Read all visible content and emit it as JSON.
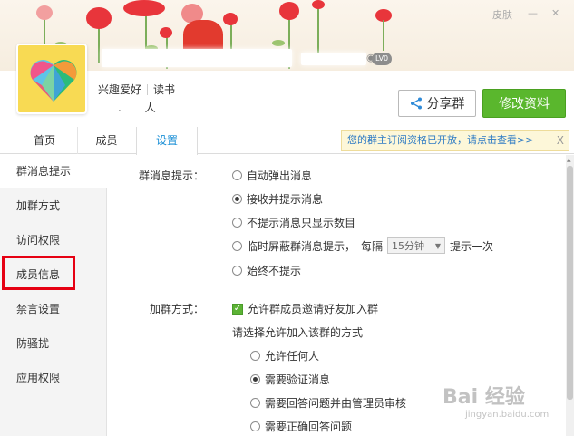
{
  "window": {
    "skin_label": "皮肤",
    "minimize": "—",
    "close": "✕"
  },
  "group": {
    "level_badge": "LV0",
    "tags": [
      "兴趣爱好",
      "读书"
    ],
    "member_dot": ".",
    "member_unit": "人"
  },
  "header": {
    "share_label": "分享群",
    "edit_label": "修改资料"
  },
  "tabs": [
    {
      "label": "首页"
    },
    {
      "label": "成员"
    },
    {
      "label": "设置"
    }
  ],
  "notice": {
    "text": "您的群主订阅资格已开放，请点击查看>>",
    "close": "X"
  },
  "sidebar": {
    "items": [
      {
        "label": "群消息提示"
      },
      {
        "label": "加群方式"
      },
      {
        "label": "访问权限"
      },
      {
        "label": "成员信息"
      },
      {
        "label": "禁言设置"
      },
      {
        "label": "防骚扰"
      },
      {
        "label": "应用权限"
      }
    ]
  },
  "settings": {
    "msg_label": "群消息提示：",
    "msg_options": [
      {
        "label": "自动弹出消息",
        "selected": false
      },
      {
        "label": "接收并提示消息",
        "selected": true
      },
      {
        "label": "不提示消息只显示数目",
        "selected": false
      },
      {
        "label": "临时屏蔽群消息提示，",
        "selected": false
      },
      {
        "label": "始终不提示",
        "selected": false
      }
    ],
    "every_label": "每隔",
    "interval_value": "15分钟",
    "interval_suffix": "提示一次",
    "join_label": "加群方式：",
    "allow_invite": "允许群成员邀请好友加入群",
    "choose_label": "请选择允许加入该群的方式",
    "join_options": [
      {
        "label": "允许任何人",
        "selected": false
      },
      {
        "label": "需要验证消息",
        "selected": true
      },
      {
        "label": "需要回答问题并由管理员审核",
        "selected": false
      },
      {
        "label": "需要正确回答问题",
        "selected": false
      }
    ]
  },
  "watermark": {
    "text": "Bai 经验",
    "sub": "jingyan.baidu.com"
  }
}
